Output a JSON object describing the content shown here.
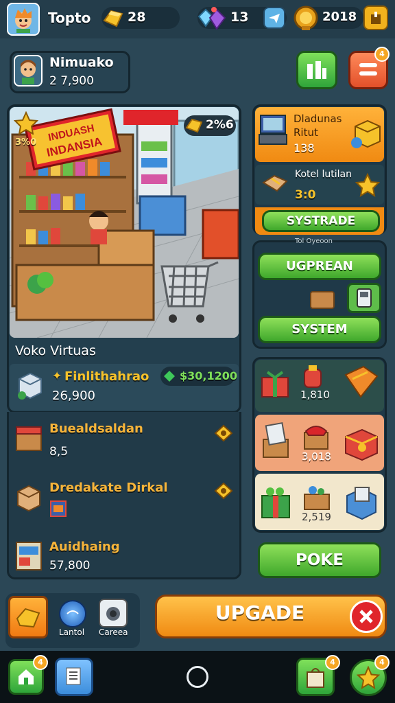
{
  "top": {
    "player_name": "Topto",
    "gold": "28",
    "gems": "13",
    "coins": "2018"
  },
  "profile": {
    "name": "Nimuako",
    "value": "2 7,900"
  },
  "store": {
    "sign_text": "INDUASH INDANSIA",
    "counter": "2%6",
    "star_label": "3%0",
    "title": "Voko Virtuas"
  },
  "summary": {
    "item_name": "Finlithahrao",
    "item_value": "26,900",
    "money": "$30,1200"
  },
  "list": [
    {
      "name": "Buealdsaldan",
      "value": "8,5"
    },
    {
      "name": "Dredakate Dirkal",
      "value": ""
    },
    {
      "name": "Auidhaing",
      "value": "57,800"
    }
  ],
  "right_top": {
    "card1_line1": "Dladunas",
    "card1_line2": "Ritut",
    "card1_value": "138",
    "card2_title": "Kotel lutilan",
    "card2_value": "3:0",
    "button": "SYSTRADE"
  },
  "right_mid": {
    "caption": "Tol Oyeoon",
    "btn_upgrade": "UGPREAN",
    "btn_system": "SYSTEM"
  },
  "right_items": {
    "row1_value": "1,810",
    "row2_value": "3,018",
    "row3_value": "2,519"
  },
  "buttons": {
    "poke": "POKE",
    "upgrade": "UPGADE"
  },
  "dock": {
    "label1": "Lantol",
    "label2": "Careea"
  },
  "notif": {
    "count": "4"
  }
}
